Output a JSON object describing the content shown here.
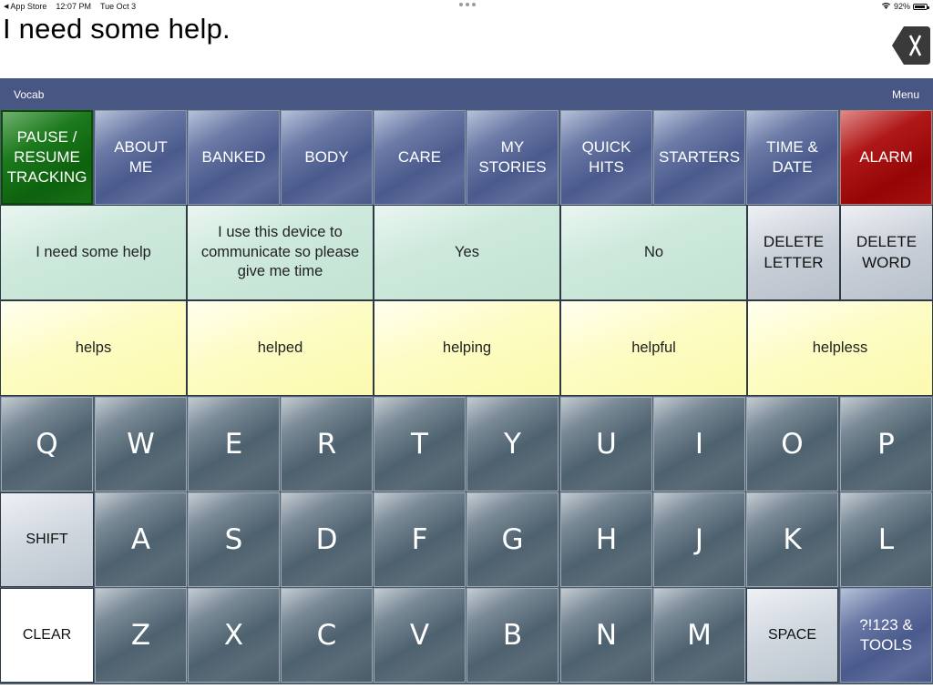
{
  "status_bar": {
    "back_app": "App Store",
    "time": "12:07 PM",
    "date": "Tue Oct 3",
    "battery": "92%",
    "battery_level_percent": 92
  },
  "message": {
    "text": "I need some help."
  },
  "vocab_bar": {
    "vocab_label": "Vocab",
    "menu_label": "Menu"
  },
  "colors": {
    "vocab_bar": "#475683",
    "category_button": "#4a5a8c",
    "pause_button": "#0d620d",
    "alarm_button": "#960606",
    "phrase_button": "#c3e3d3",
    "prediction_button": "#fbfaae",
    "key_button": "#4e616e"
  },
  "categories": [
    {
      "label": "PAUSE / RESUME TRACKING",
      "style": "green"
    },
    {
      "label": "ABOUT ME",
      "style": "blue"
    },
    {
      "label": "BANKED",
      "style": "blue"
    },
    {
      "label": "BODY",
      "style": "blue"
    },
    {
      "label": "CARE",
      "style": "blue"
    },
    {
      "label": "MY STORIES",
      "style": "blue"
    },
    {
      "label": "QUICK HITS",
      "style": "blue"
    },
    {
      "label": "STARTERS",
      "style": "blue"
    },
    {
      "label": "TIME & DATE",
      "style": "blue"
    },
    {
      "label": "ALARM",
      "style": "red"
    }
  ],
  "phrases": [
    {
      "label": "I need some help"
    },
    {
      "label": "I use this device to communicate so please give me time"
    },
    {
      "label": "Yes"
    },
    {
      "label": "No"
    }
  ],
  "edit_buttons": {
    "delete_letter": "DELETE LETTER",
    "delete_word": "DELETE WORD"
  },
  "predictions": [
    {
      "label": "helps"
    },
    {
      "label": "helped"
    },
    {
      "label": "helping"
    },
    {
      "label": "helpful"
    },
    {
      "label": "helpless"
    }
  ],
  "keyboard": {
    "row1": [
      "Q",
      "W",
      "E",
      "R",
      "T",
      "Y",
      "U",
      "I",
      "O",
      "P"
    ],
    "row2_first": "SHIFT",
    "row2": [
      "A",
      "S",
      "D",
      "F",
      "G",
      "H",
      "J",
      "K",
      "L"
    ],
    "row3_first": "CLEAR",
    "row3": [
      "Z",
      "X",
      "C",
      "V",
      "B",
      "N",
      "M"
    ],
    "space": "SPACE",
    "tools": "?!123 & TOOLS"
  }
}
